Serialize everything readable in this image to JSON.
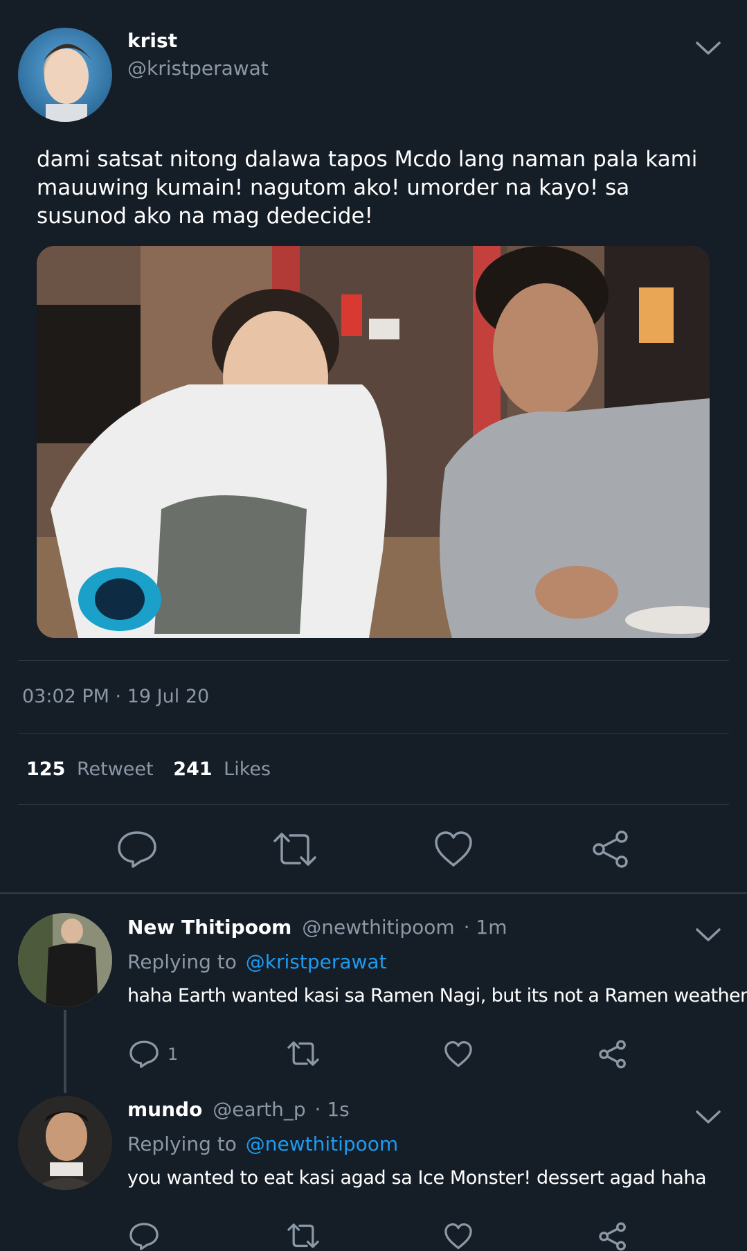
{
  "colors": {
    "background": "#151d27",
    "text": "#ffffff",
    "muted": "#8b98a5",
    "link": "#1d9bf0",
    "divider": "#2b3640"
  },
  "tweet": {
    "author_name": "krist",
    "author_handle": "@kristperawat",
    "text": "dami satsat nitong dalawa tapos Mcdo lang naman pala kami mauuwing kumain! nagutom ako! umorder na kayo! sa susunod ako na mag dedecide!",
    "timestamp": "03:02 PM · 19 Jul 20",
    "retweet_count": "125",
    "retweet_label": "Retweet",
    "likes_count": "241",
    "likes_label": "Likes",
    "actions": [
      "reply-icon",
      "retweet-icon",
      "like-icon",
      "share-icon"
    ]
  },
  "replies": [
    {
      "name": "New Thitipoom",
      "handle": "@newthitipoom",
      "time": "· 1m",
      "replying_prefix": "Replying to",
      "replying_to": "@kristperawat",
      "text": "haha Earth wanted kasi sa Ramen Nagi, but its not a Ramen weather",
      "reply_count": "1"
    },
    {
      "name": "mundo",
      "handle": "@earth_p",
      "time": "· 1s",
      "replying_prefix": "Replying to",
      "replying_to": "@newthitipoom",
      "text": "you wanted to eat kasi agad sa Ice Monster! dessert agad haha",
      "reply_count": ""
    }
  ]
}
